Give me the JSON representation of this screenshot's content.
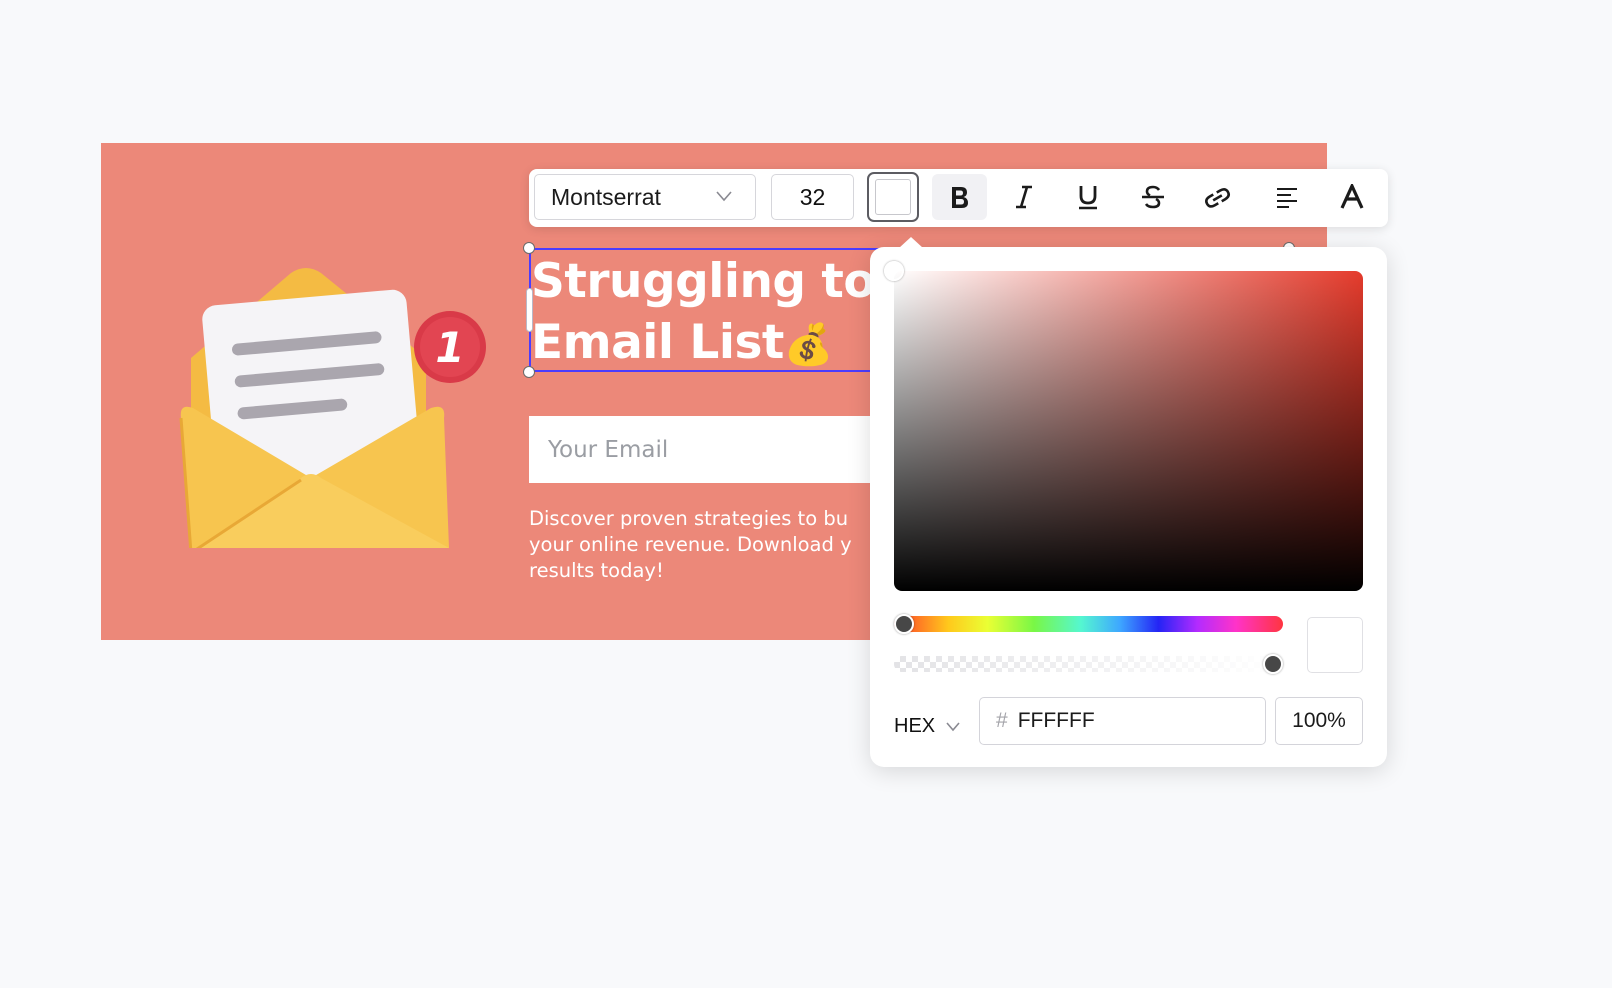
{
  "banner": {
    "bg_color": "#ec8879",
    "headline_line1": "Struggling to",
    "headline_line2": "Email List",
    "headline_emoji": "💰",
    "badge_number": "1",
    "email_placeholder": "Your Email",
    "description_lines": [
      "Discover proven strategies to bu",
      "your online revenue. Download y",
      "results today!"
    ]
  },
  "toolbar": {
    "font_family": "Montserrat",
    "font_size": "32",
    "text_color": "#FFFFFF",
    "buttons": [
      "bold",
      "italic",
      "underline",
      "strikethrough",
      "link",
      "align-left",
      "text-format"
    ]
  },
  "color_picker": {
    "hue_color": "#e53b2c",
    "format": "HEX",
    "hash": "#",
    "hex_value": "FFFFFF",
    "alpha": "100%",
    "hue_fraction": 0,
    "alpha_fraction": 1
  }
}
